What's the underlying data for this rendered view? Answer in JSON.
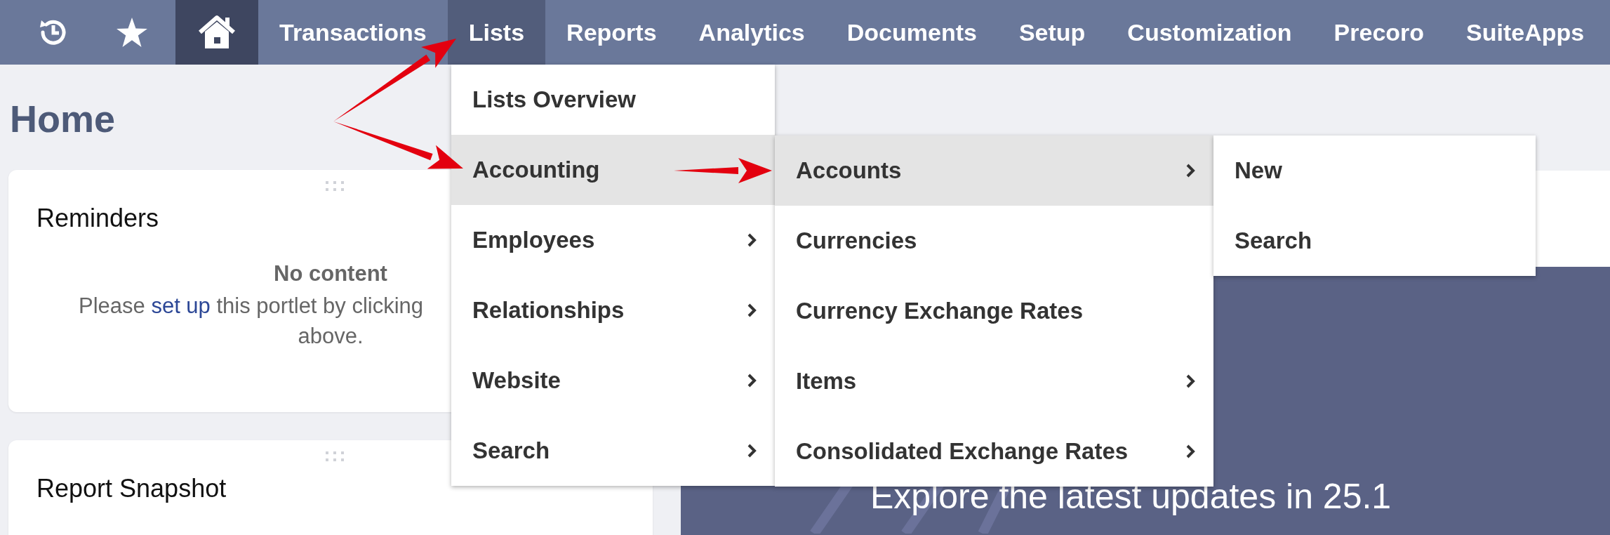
{
  "nav": {
    "icons": [
      {
        "kind": "history",
        "selected": false
      },
      {
        "kind": "star",
        "selected": false
      },
      {
        "kind": "home",
        "selected": true
      }
    ],
    "items": [
      {
        "label": "Transactions",
        "selected": false
      },
      {
        "label": "Lists",
        "selected": true
      },
      {
        "label": "Reports",
        "selected": false
      },
      {
        "label": "Analytics",
        "selected": false
      },
      {
        "label": "Documents",
        "selected": false
      },
      {
        "label": "Setup",
        "selected": false
      },
      {
        "label": "Customization",
        "selected": false
      },
      {
        "label": "Precoro",
        "selected": false
      },
      {
        "label": "SuiteApps",
        "selected": false
      }
    ]
  },
  "page_title": "Home",
  "reminders": {
    "title": "Reminders",
    "empty_title": "No content",
    "text_before_link": "Please",
    "link": "set up",
    "text_after_link": "this portlet by clicking",
    "text_line_2": "above."
  },
  "report_snapshot": {
    "title": "Report Snapshot"
  },
  "banner": {
    "headline": "Explore the latest updates in 25.1"
  },
  "menus": [
    [
      {
        "label": "Lists Overview",
        "submenu": false,
        "selected": false
      },
      {
        "label": "Accounting",
        "submenu": false,
        "selected": true
      },
      {
        "label": "Employees",
        "submenu": true,
        "selected": false
      },
      {
        "label": "Relationships",
        "submenu": true,
        "selected": false
      },
      {
        "label": "Website",
        "submenu": true,
        "selected": false
      },
      {
        "label": "Search",
        "submenu": true,
        "selected": false
      }
    ],
    [
      {
        "label": "Accounts",
        "submenu": true,
        "selected": true
      },
      {
        "label": "Currencies",
        "submenu": false,
        "selected": false
      },
      {
        "label": "Currency Exchange Rates",
        "submenu": false,
        "selected": false
      },
      {
        "label": "Items",
        "submenu": true,
        "selected": false
      },
      {
        "label": "Consolidated Exchange Rates",
        "submenu": true,
        "selected": false
      }
    ],
    [
      {
        "label": "New",
        "submenu": false,
        "selected": false
      },
      {
        "label": "Search",
        "submenu": false,
        "selected": false
      }
    ]
  ]
}
